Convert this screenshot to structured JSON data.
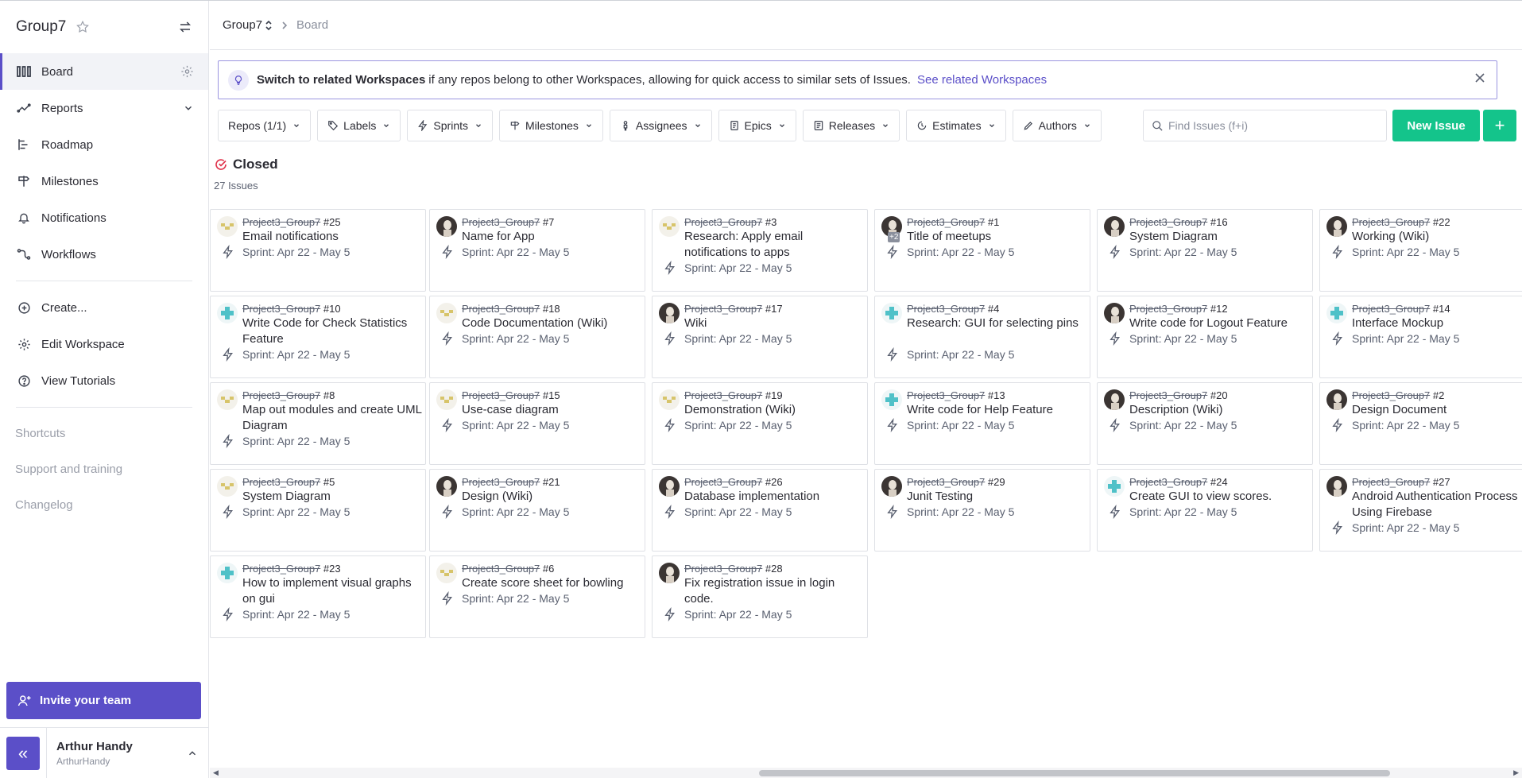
{
  "workspace": {
    "name": "Group7"
  },
  "sidebar": {
    "items": [
      {
        "label": "Board",
        "icon": "board-icon"
      },
      {
        "label": "Reports",
        "icon": "reports-icon"
      },
      {
        "label": "Roadmap",
        "icon": "roadmap-icon"
      },
      {
        "label": "Milestones",
        "icon": "milestone-icon"
      },
      {
        "label": "Notifications",
        "icon": "bell-icon"
      },
      {
        "label": "Workflows",
        "icon": "workflow-icon"
      }
    ],
    "actions": [
      {
        "label": "Create...",
        "icon": "plus-circle-icon"
      },
      {
        "label": "Edit Workspace",
        "icon": "gear-icon"
      },
      {
        "label": "View Tutorials",
        "icon": "help-icon"
      }
    ],
    "links": [
      "Shortcuts",
      "Support and training",
      "Changelog"
    ],
    "invite_label": "Invite your team",
    "collapse_label": "«",
    "user": {
      "name": "Arthur Handy",
      "handle": "ArthurHandy"
    }
  },
  "breadcrumb": {
    "workspace": "Group7",
    "page": "Board"
  },
  "banner": {
    "bold": "Switch to related Workspaces",
    "text": "if any repos belong to other Workspaces, allowing for quick access to similar sets of Issues.",
    "link": "See related Workspaces"
  },
  "filters": [
    "Repos (1/1)",
    "Labels",
    "Sprints",
    "Milestones",
    "Assignees",
    "Epics",
    "Releases",
    "Estimates",
    "Authors"
  ],
  "search": {
    "placeholder": "Find Issues (f+i)"
  },
  "new_issue_label": "New Issue",
  "plus_label": "+",
  "pipeline": {
    "name": "Closed",
    "count": "27 Issues"
  },
  "issues": [
    {
      "repo": "Project3_Group7",
      "num": "#25",
      "title": "Email notifications",
      "sprint": "Sprint: Apr 22 - May 5",
      "avatar": "yellow"
    },
    {
      "repo": "Project3_Group7",
      "num": "#7",
      "title": "Name for App",
      "sprint": "Sprint: Apr 22 - May 5",
      "avatar": "photo"
    },
    {
      "repo": "Project3_Group7",
      "num": "#3",
      "title": "Research: Apply email notifications to apps",
      "sprint": "Sprint: Apr 22 - May 5",
      "avatar": "yellow"
    },
    {
      "repo": "Project3_Group7",
      "num": "#1",
      "title": "Title of meetups",
      "sprint": "Sprint: Apr 22 - May 5",
      "avatar": "photo",
      "extra": "+2"
    },
    {
      "repo": "Project3_Group7",
      "num": "#16",
      "title": "System Diagram",
      "sprint": "Sprint: Apr 22 - May 5",
      "avatar": "photo"
    },
    {
      "repo": "Project3_Group7",
      "num": "#22",
      "title": "Working (Wiki)",
      "sprint": "Sprint: Apr 22 - May 5",
      "avatar": "photo"
    },
    {
      "repo": "Project3_Group7",
      "num": "#10",
      "title": "Write Code for Check Statistics Feature",
      "sprint": "Sprint: Apr 22 - May 5",
      "avatar": "teal"
    },
    {
      "repo": "Project3_Group7",
      "num": "#18",
      "title": "Code Documentation (Wiki)",
      "sprint": "Sprint: Apr 22 - May 5",
      "avatar": "yellow"
    },
    {
      "repo": "Project3_Group7",
      "num": "#17",
      "title": "Wiki",
      "sprint": "Sprint: Apr 22 - May 5",
      "avatar": "photo"
    },
    {
      "repo": "Project3_Group7",
      "num": "#4",
      "title": "Research: GUI for selecting pins",
      "sprint": "Sprint: Apr 22 - May 5",
      "avatar": "teal"
    },
    {
      "repo": "Project3_Group7",
      "num": "#12",
      "title": "Write code for Logout Feature",
      "sprint": "Sprint: Apr 22 - May 5",
      "avatar": "photo"
    },
    {
      "repo": "Project3_Group7",
      "num": "#14",
      "title": "Interface Mockup",
      "sprint": "Sprint: Apr 22 - May 5",
      "avatar": "teal"
    },
    {
      "repo": "Project3_Group7",
      "num": "#8",
      "title": "Map out modules and create UML Diagram",
      "sprint": "Sprint: Apr 22 - May 5",
      "avatar": "yellow"
    },
    {
      "repo": "Project3_Group7",
      "num": "#15",
      "title": "Use-case diagram",
      "sprint": "Sprint: Apr 22 - May 5",
      "avatar": "yellow"
    },
    {
      "repo": "Project3_Group7",
      "num": "#19",
      "title": "Demonstration (Wiki)",
      "sprint": "Sprint: Apr 22 - May 5",
      "avatar": "yellow"
    },
    {
      "repo": "Project3_Group7",
      "num": "#13",
      "title": "Write code for Help Feature",
      "sprint": "Sprint: Apr 22 - May 5",
      "avatar": "teal"
    },
    {
      "repo": "Project3_Group7",
      "num": "#20",
      "title": "Description (Wiki)",
      "sprint": "Sprint: Apr 22 - May 5",
      "avatar": "photo"
    },
    {
      "repo": "Project3_Group7",
      "num": "#2",
      "title": "Design Document",
      "sprint": "Sprint: Apr 22 - May 5",
      "avatar": "photo"
    },
    {
      "repo": "Project3_Group7",
      "num": "#5",
      "title": "System Diagram",
      "sprint": "Sprint: Apr 22 - May 5",
      "avatar": "yellow"
    },
    {
      "repo": "Project3_Group7",
      "num": "#21",
      "title": "Design (Wiki)",
      "sprint": "Sprint: Apr 22 - May 5",
      "avatar": "photo"
    },
    {
      "repo": "Project3_Group7",
      "num": "#26",
      "title": "Database implementation",
      "sprint": "Sprint: Apr 22 - May 5",
      "avatar": "photo"
    },
    {
      "repo": "Project3_Group7",
      "num": "#29",
      "title": "Junit Testing",
      "sprint": "Sprint: Apr 22 - May 5",
      "avatar": "photo"
    },
    {
      "repo": "Project3_Group7",
      "num": "#24",
      "title": "Create GUI to view scores.",
      "sprint": "Sprint: Apr 22 - May 5",
      "avatar": "teal"
    },
    {
      "repo": "Project3_Group7",
      "num": "#27",
      "title": "Android Authentication Process Using Firebase",
      "sprint": "Sprint: Apr 22 - May 5",
      "avatar": "photo"
    },
    {
      "repo": "Project3_Group7",
      "num": "#23",
      "title": "How to implement visual graphs on gui",
      "sprint": "Sprint: Apr 22 - May 5",
      "avatar": "teal"
    },
    {
      "repo": "Project3_Group7",
      "num": "#6",
      "title": "Create score sheet for bowling",
      "sprint": "Sprint: Apr 22 - May 5",
      "avatar": "yellow"
    },
    {
      "repo": "Project3_Group7",
      "num": "#28",
      "title": "Fix registration issue in login code.",
      "sprint": "Sprint: Apr 22 - May 5",
      "avatar": "photo"
    }
  ],
  "colors": {
    "accent": "#5b4fc8",
    "success": "#14c48b",
    "closed": "#e0324b"
  }
}
